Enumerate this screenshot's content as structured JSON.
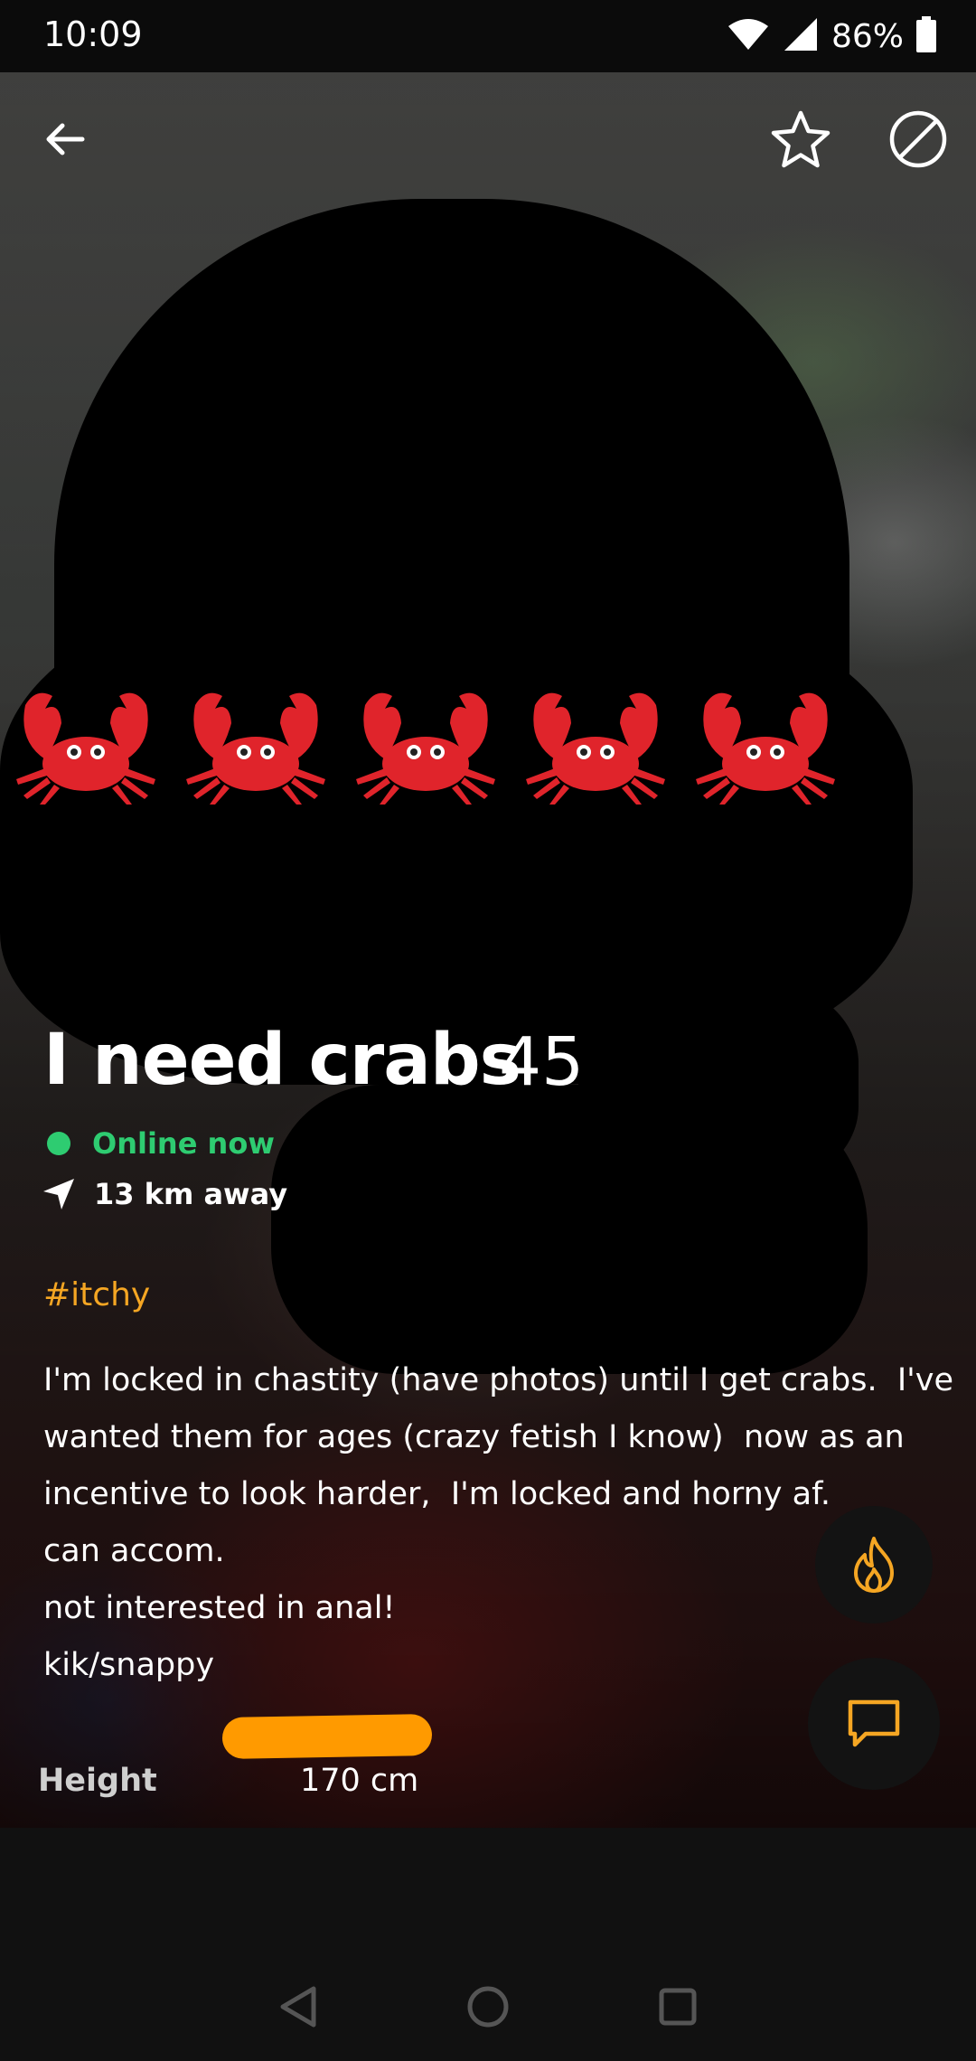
{
  "status_bar": {
    "time": "10:09",
    "battery": "86%",
    "icons": [
      "wifi-icon",
      "cell-signal-icon",
      "battery-icon"
    ]
  },
  "nav": {
    "icons": [
      "back-arrow-icon",
      "star-icon",
      "block-icon"
    ]
  },
  "profile": {
    "display_name": "I need crabs",
    "age": "45",
    "status": "Online now",
    "distance": "13 km away",
    "tag": "#itchy",
    "bio_lines": [
      "I'm locked in chastity (have photos) until I get crabs.  I've",
      "wanted them for ages (crazy fetish I know)  now as an",
      "incentive to look harder,  I'm locked and horny af.",
      "can accom.",
      "not interested in anal!",
      "kik/snappy"
    ],
    "height_label": "Height",
    "height_value": "170 cm"
  },
  "actions": {
    "tap_icon": "flame-icon",
    "chat_icon": "chat-icon"
  },
  "colors": {
    "accent": "#f5a623",
    "online": "#2ecc71",
    "background": "#111111",
    "fab": "#131313"
  },
  "system_nav": [
    "back-triangle-icon",
    "home-circle-icon",
    "recents-square-icon"
  ]
}
